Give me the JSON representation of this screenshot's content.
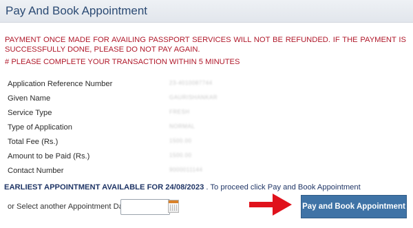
{
  "header": {
    "title": "Pay And Book Appointment"
  },
  "notice": "PAYMENT ONCE MADE FOR AVAILING PASSPORT SERVICES WILL NOT BE REFUNDED. IF THE PAYMENT IS SUCCESSFULLY DONE, PLEASE DO NOT PAY AGAIN.",
  "warning": "# PLEASE COMPLETE YOUR TRANSACTION WITHIN 5 MINUTES",
  "details": [
    {
      "label": "Application Reference Number",
      "value": "23-4010087744"
    },
    {
      "label": "Given Name",
      "value": "GAURISHANKAR"
    },
    {
      "label": "Service Type",
      "value": "FRESH"
    },
    {
      "label": "Type of Application",
      "value": "NORMAL"
    },
    {
      "label": "Total Fee (Rs.)",
      "value": "1500.00"
    },
    {
      "label": "Amount to be Paid (Rs.)",
      "value": "1500.00"
    },
    {
      "label": "Contact Number",
      "value": "9000011144"
    }
  ],
  "earliest": {
    "strong": "EARLIEST APPOINTMENT AVAILABLE FOR 24/08/2023",
    "rest": " . To proceed click Pay and Book Appointment"
  },
  "other_date": {
    "label": "or Select another Appointment Date",
    "value": "",
    "placeholder": ""
  },
  "pay_button": {
    "label": "Pay and Book Appointment"
  },
  "colors": {
    "title": "#2b4a73",
    "notice": "#b0182a",
    "button": "#3f73a6",
    "arrow": "#e0121c"
  }
}
